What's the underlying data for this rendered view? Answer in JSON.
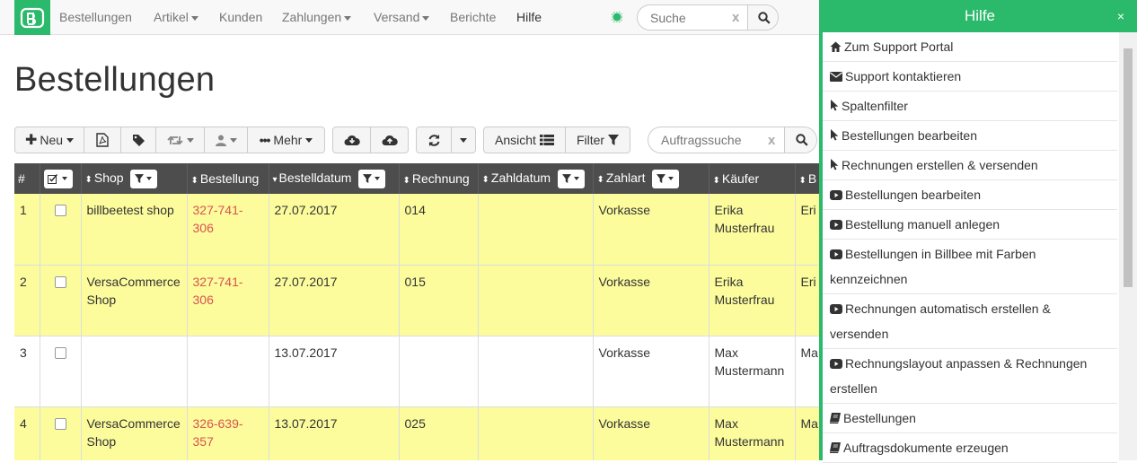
{
  "nav": {
    "items": [
      {
        "label": "Bestellungen",
        "dropdown": false
      },
      {
        "label": "Artikel",
        "dropdown": true
      },
      {
        "label": "Kunden",
        "dropdown": false
      },
      {
        "label": "Zahlungen",
        "dropdown": true
      },
      {
        "label": "Versand",
        "dropdown": true
      },
      {
        "label": "Berichte",
        "dropdown": false
      },
      {
        "label": "Hilfe",
        "dropdown": false
      }
    ],
    "search_placeholder": "Suche",
    "brand_color": "#2bba6c"
  },
  "page": {
    "title": "Bestellungen"
  },
  "toolbar": {
    "new_label": "Neu",
    "more_label": "Mehr",
    "view_label": "Ansicht",
    "filter_label": "Filter",
    "order_search_placeholder": "Auftragssuche"
  },
  "table": {
    "headers": [
      "#",
      "",
      "Shop",
      "Bestellung",
      "Bestelldatum",
      "Rechnung",
      "Zahldatum",
      "Zahlart",
      "Käufer",
      "B"
    ],
    "rows": [
      {
        "num": "1",
        "shop": "billbeetest shop",
        "order": "327-741-306",
        "date": "27.07.2017",
        "invoice": "014",
        "paydate": "",
        "payment": "Vorkasse",
        "buyer": "Erika Musterfrau",
        "extra": "Eri Mu",
        "highlight": true
      },
      {
        "num": "2",
        "shop": "VersaCommerce Shop",
        "order": "327-741-306",
        "date": "27.07.2017",
        "invoice": "015",
        "paydate": "",
        "payment": "Vorkasse",
        "buyer": "Erika Musterfrau",
        "extra": "Eri Mu",
        "highlight": true
      },
      {
        "num": "3",
        "shop": "",
        "order": "",
        "date": "13.07.2017",
        "invoice": "",
        "paydate": "",
        "payment": "Vorkasse",
        "buyer": "Max Mustermann",
        "extra": "Ma Mu",
        "highlight": false
      },
      {
        "num": "4",
        "shop": "VersaCommerce Shop",
        "order": "326-639-357",
        "date": "13.07.2017",
        "invoice": "025",
        "paydate": "",
        "payment": "Vorkasse",
        "buyer": "Max Mustermann",
        "extra": "Ma Mu",
        "highlight": true
      }
    ]
  },
  "help": {
    "title": "Hilfe",
    "close_label": "×",
    "items": [
      {
        "icon": "home-icon",
        "label": "Zum Support Portal"
      },
      {
        "icon": "envelope-icon",
        "label": "Support kontaktieren"
      },
      {
        "icon": "cursor-icon",
        "label": "Spaltenfilter"
      },
      {
        "icon": "cursor-icon",
        "label": "Bestellungen bearbeiten"
      },
      {
        "icon": "cursor-icon",
        "label": "Rechnungen erstellen & versenden"
      },
      {
        "icon": "video-icon",
        "label": "Bestellungen bearbeiten"
      },
      {
        "icon": "video-icon",
        "label": "Bestellung manuell anlegen"
      },
      {
        "icon": "video-icon",
        "label": "Bestellungen in Billbee mit Farben kennzeichnen"
      },
      {
        "icon": "video-icon",
        "label": "Rechnungen automatisch erstellen & versenden"
      },
      {
        "icon": "video-icon",
        "label": "Rechnungslayout anpassen & Rechnungen erstellen"
      },
      {
        "icon": "book-icon",
        "label": "Bestellungen"
      },
      {
        "icon": "book-icon",
        "label": "Auftragsdokumente erzeugen"
      }
    ]
  }
}
